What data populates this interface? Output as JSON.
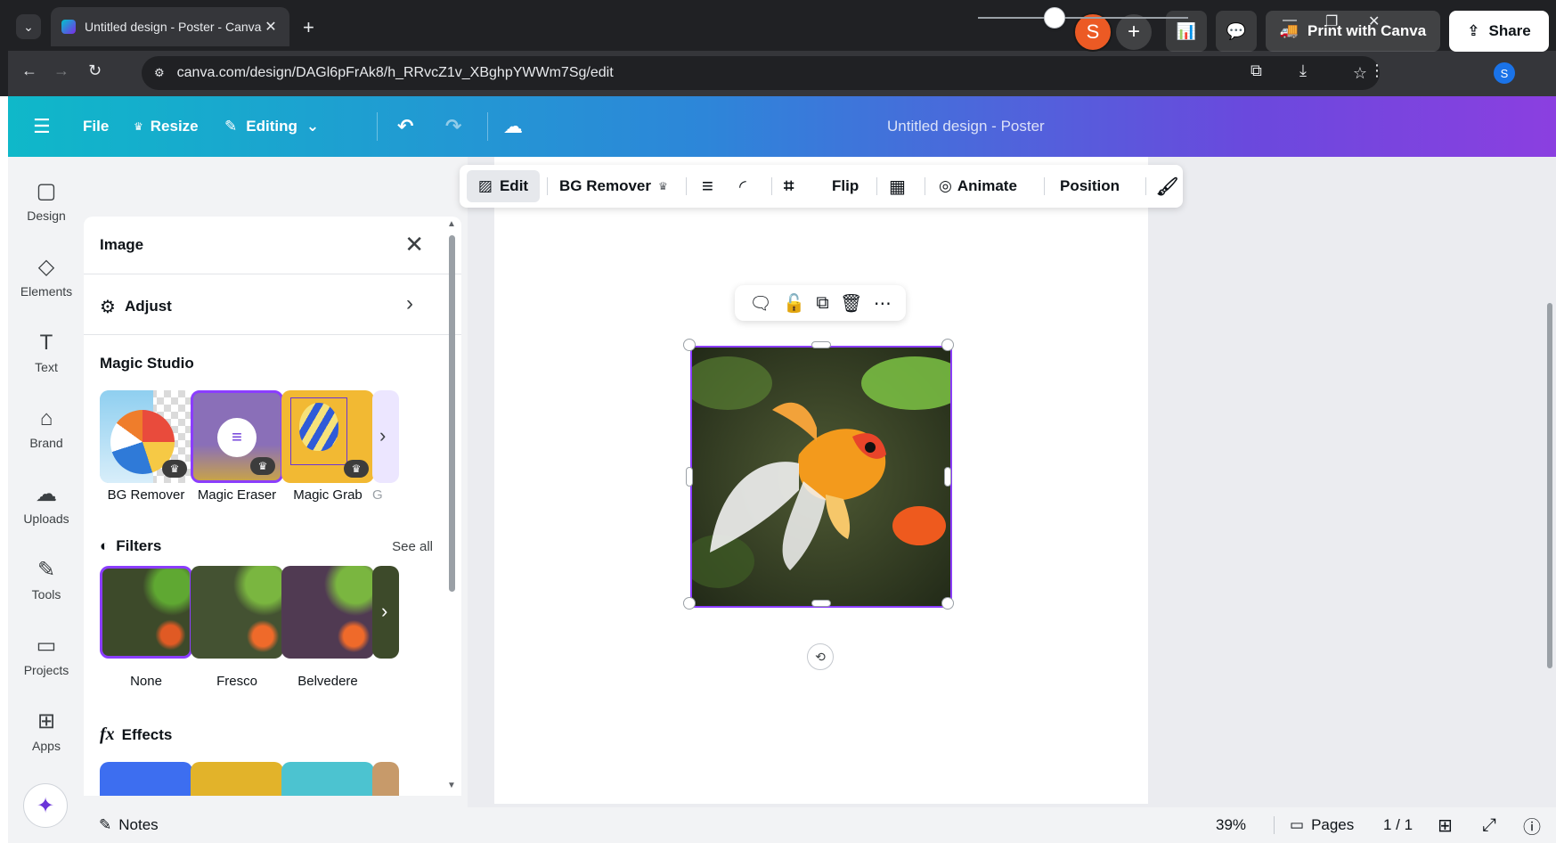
{
  "browser": {
    "tab_title": "Untitled design - Poster - Canva",
    "url": "canva.com/design/DAGl6pFrAk8/h_RRvcZ1v_XBghpYWWm7Sg/edit",
    "profile_initial": "S"
  },
  "header": {
    "file_label": "File",
    "resize_label": "Resize",
    "editing_label": "Editing",
    "doc_title": "Untitled design - Poster",
    "avatar_initial": "S",
    "print_label": "Print with Canva",
    "share_label": "Share"
  },
  "rail": {
    "items": [
      {
        "label": "Design",
        "icon": "design-icon"
      },
      {
        "label": "Elements",
        "icon": "elements-icon"
      },
      {
        "label": "Text",
        "icon": "text-icon"
      },
      {
        "label": "Brand",
        "icon": "brand-icon"
      },
      {
        "label": "Uploads",
        "icon": "uploads-icon"
      },
      {
        "label": "Tools",
        "icon": "tools-icon"
      },
      {
        "label": "Projects",
        "icon": "projects-icon"
      },
      {
        "label": "Apps",
        "icon": "apps-icon"
      }
    ]
  },
  "panel": {
    "title": "Image",
    "adjust_label": "Adjust",
    "magic_title": "Magic Studio",
    "magic_items": [
      "BG Remover",
      "Magic Eraser",
      "Magic Grab",
      "G"
    ],
    "filters_title": "Filters",
    "see_all": "See all",
    "filter_items": [
      "None",
      "Fresco",
      "Belvedere"
    ],
    "effects_title": "Effects"
  },
  "toolbar": {
    "edit_label": "Edit",
    "bg_remover_label": "BG Remover",
    "flip_label": "Flip",
    "animate_label": "Animate",
    "position_label": "Position"
  },
  "footer": {
    "notes_label": "Notes",
    "zoom": "39%",
    "pages_label": "Pages",
    "page_count": "1 / 1"
  },
  "colors": {
    "accent": "#8b3dff",
    "header_start": "#0fb8c9",
    "header_end": "#8b3fe0"
  }
}
